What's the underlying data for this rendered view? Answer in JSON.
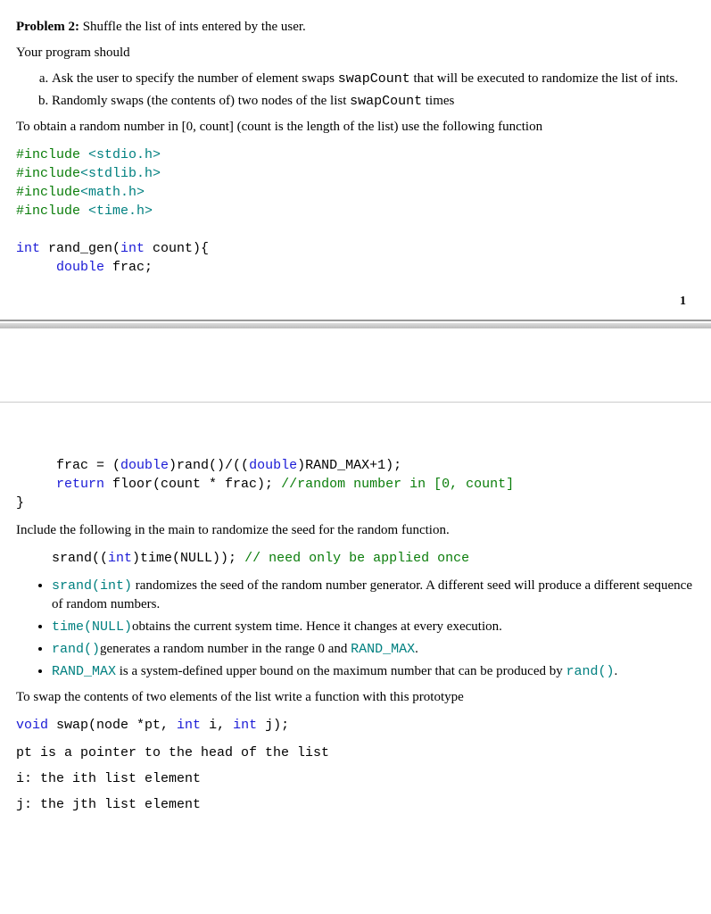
{
  "problem": {
    "label": "Problem 2:",
    "title": " Shuffle the list of ints entered by the user.",
    "intro": "Your program should",
    "items": [
      {
        "text_a": "Ask the user to specify the number of element swaps ",
        "code_a": "swapCount",
        "text_b": "  that will be executed to randomize the list of ints."
      },
      {
        "text_a": "Randomly swaps (the contents of) two nodes of the list ",
        "code_a": "swapCount",
        "text_b": " times"
      }
    ],
    "random_intro": "To obtain a random number in [0, count] (count is the length of the list) use the following function"
  },
  "code1": {
    "l1a": "#include ",
    "l1b": "<stdio.h>",
    "l2a": "#include",
    "l2b": "<stdlib.h>",
    "l3a": "#include",
    "l3b": "<math.h>",
    "l4a": "#include ",
    "l4b": "<time.h>",
    "l5a": "int",
    "l5b": " rand_gen(",
    "l5c": "int",
    "l5d": " count){",
    "l6a": "double",
    "l6b": " frac;"
  },
  "page_num": "1",
  "code2": {
    "l1a": "frac = (",
    "l1b": "double",
    "l1c": ")rand()/((",
    "l1d": "double",
    "l1e": ")RAND_MAX+1);",
    "l2a": "return",
    "l2b": " floor(count * frac); ",
    "l2c": "//random number in [0, count]",
    "l3": "}"
  },
  "seed": {
    "intro": "Include the following in the main to randomize the seed for the random function.",
    "line_a": "srand((",
    "line_b": "int",
    "line_c": ")time(NULL)); ",
    "line_d": "// need only be applied once"
  },
  "bullets": {
    "b1_code": "srand(int)",
    "b1_text": " randomizes the seed of the random number generator. A different seed will produce a different sequence of random numbers.",
    "b2_code": "time(NULL)",
    "b2_text": "obtains the current system time. Hence it changes at every execution.",
    "b3_code": "rand()",
    "b3_text": "generates a random number in the range 0 and ",
    "b3_code2": "RAND_MAX",
    "b3_dot": ".",
    "b4_code": "RAND_MAX",
    "b4_text": " is a system-defined upper bound on the maximum number that can be produced by ",
    "b4_code2": "rand()",
    "b4_dot": "."
  },
  "swap": {
    "intro": "To swap the contents of two elements of the list write a function with this prototype",
    "proto_a": "void",
    "proto_b": " swap(node *pt, ",
    "proto_c": "int",
    "proto_d": " i, ",
    "proto_e": "int",
    "proto_f": " j);",
    "pt": "pt is a pointer to the head of the list",
    "i": "i: the ith list element",
    "j": "j: the jth list element"
  }
}
